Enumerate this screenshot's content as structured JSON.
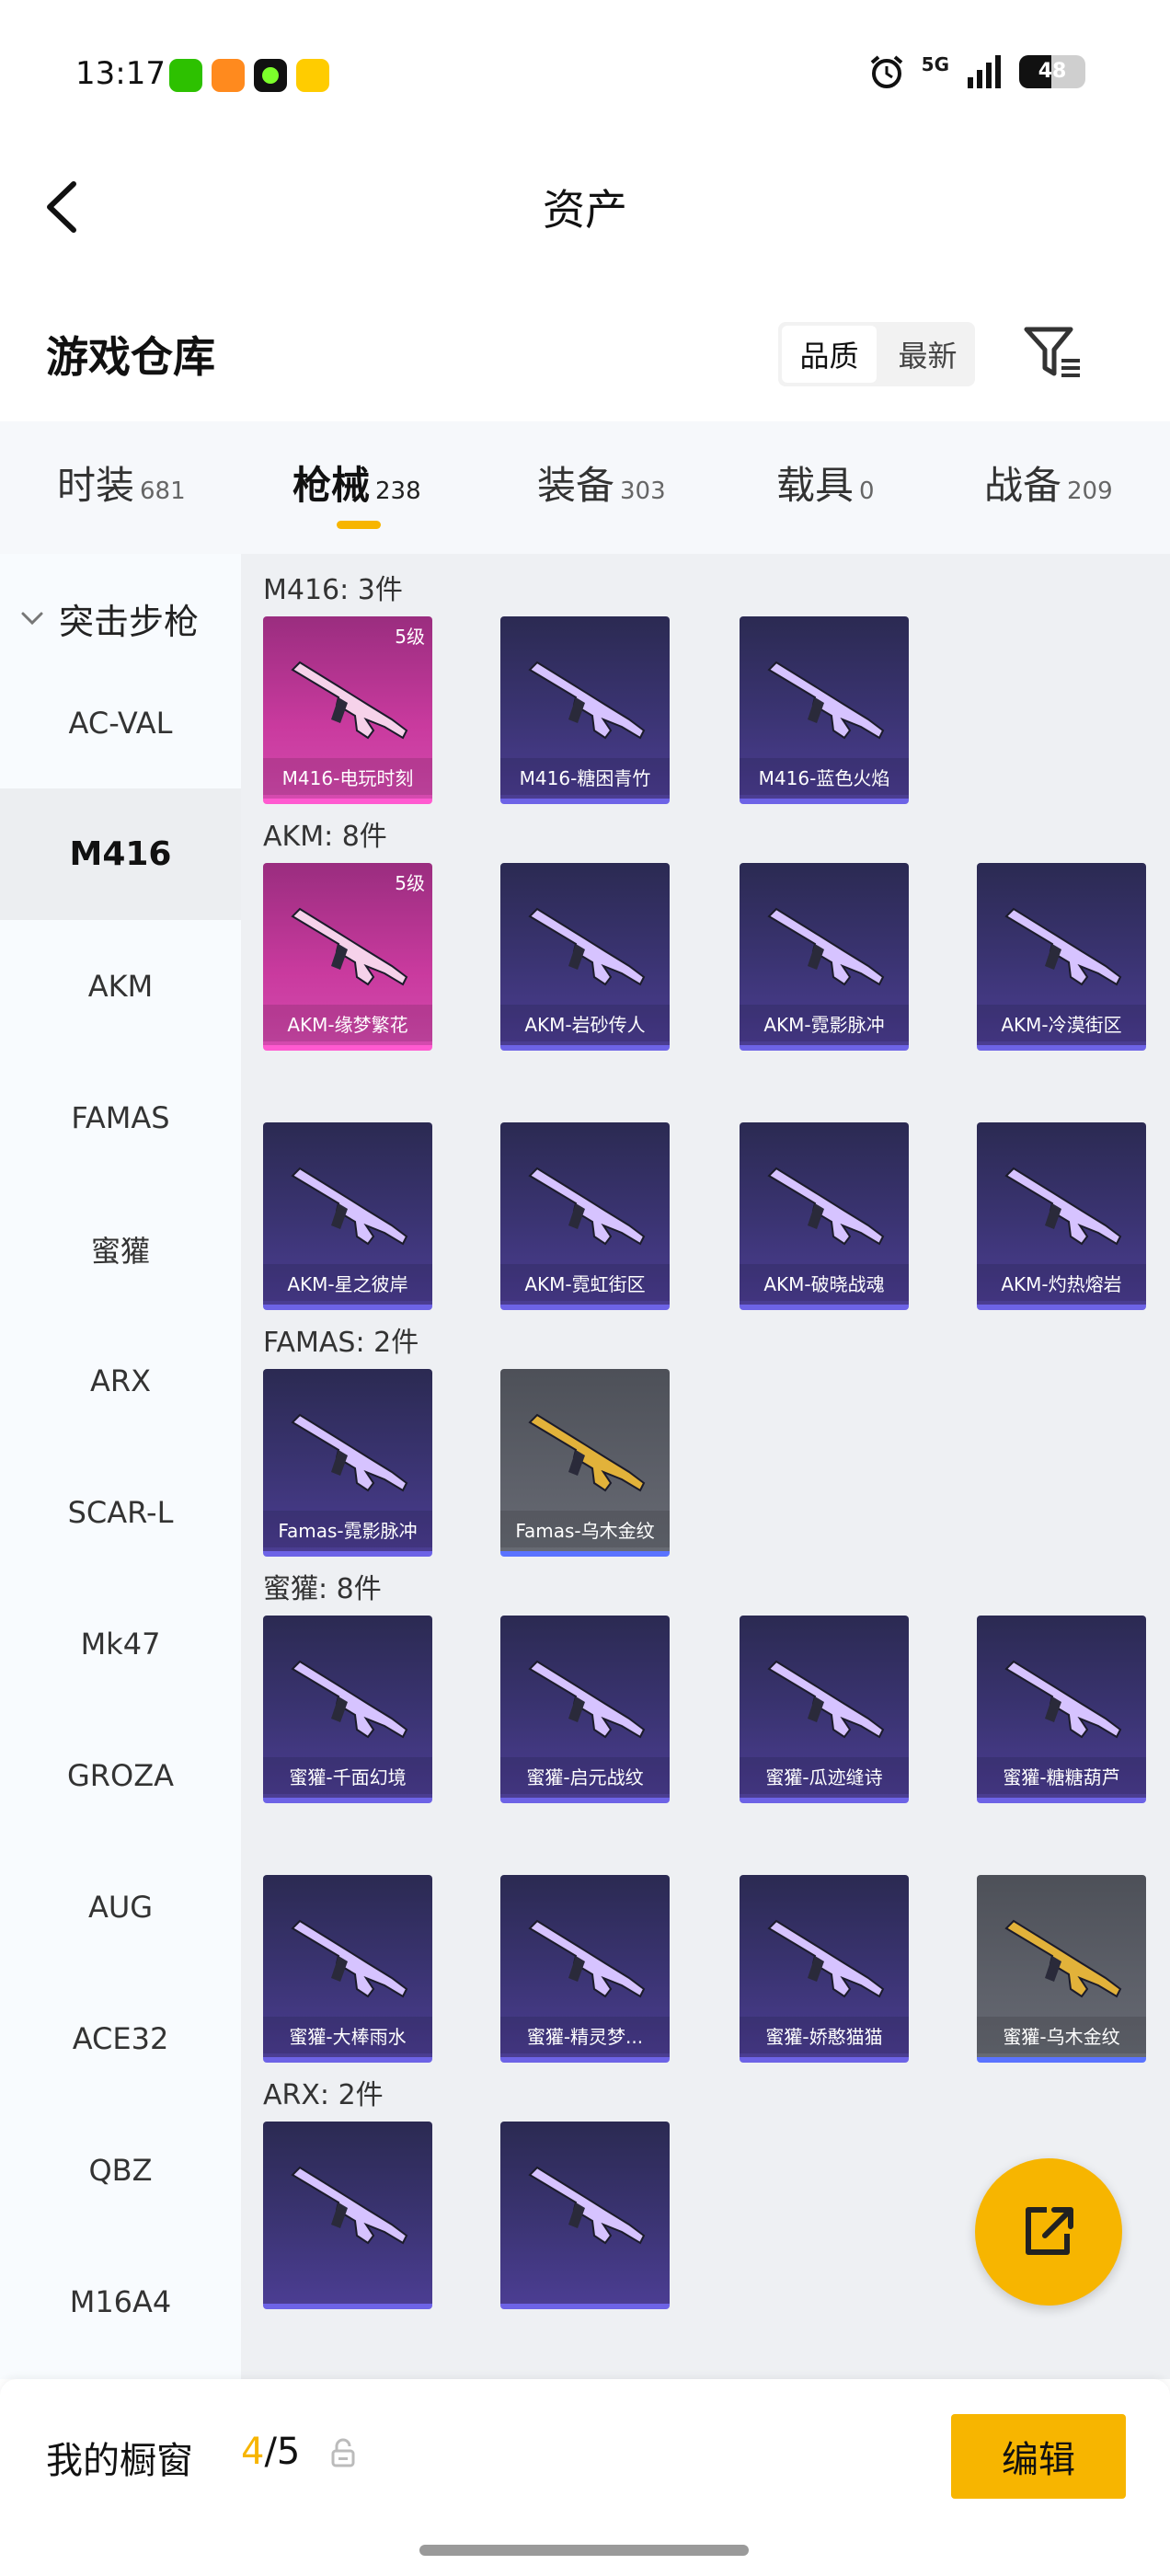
{
  "status_bar": {
    "time": "13:17",
    "network": "5G",
    "battery": "48",
    "battery_level": 0.48,
    "app_icons": [
      {
        "name": "wechat-icon",
        "color": "#2dc100"
      },
      {
        "name": "orange-app-icon",
        "color": "#ff8a1e"
      },
      {
        "name": "green-dot-app-icon",
        "color": "#111111"
      },
      {
        "name": "yellow-app-icon",
        "color": "#ffcc00"
      }
    ]
  },
  "header": {
    "title": "资产"
  },
  "warehouse": {
    "title": "游戏仓库",
    "sort_options": [
      "品质",
      "最新"
    ],
    "active_sort": 0
  },
  "tabs": [
    {
      "label": "时装",
      "count": "681"
    },
    {
      "label": "枪械",
      "count": "238",
      "active": true
    },
    {
      "label": "装备",
      "count": "303"
    },
    {
      "label": "载具",
      "count": "0"
    },
    {
      "label": "战备",
      "count": "209"
    }
  ],
  "sidebar": {
    "category": "突击步枪",
    "items": [
      "AC-VAL",
      "M416",
      "AKM",
      "FAMAS",
      "蜜獾",
      "ARX",
      "SCAR-L",
      "Mk47",
      "GROZA",
      "AUG",
      "ACE32",
      "QBZ",
      "M16A4"
    ],
    "selected": 1
  },
  "groups": [
    {
      "title": "M416: 3件",
      "items": [
        {
          "label": "M416-电玩时刻",
          "level": "5级",
          "style": "pink"
        },
        {
          "label": "M416-糖困青竹",
          "style": "purple"
        },
        {
          "label": "M416-蓝色火焰",
          "style": "purple"
        }
      ]
    },
    {
      "title": "AKM: 8件",
      "items": [
        {
          "label": "AKM-缘梦繁花",
          "level": "5级",
          "style": "pink"
        },
        {
          "label": "AKM-岩砂传人",
          "style": "purple"
        },
        {
          "label": "AKM-霓影脉冲",
          "style": "purple"
        },
        {
          "label": "AKM-冷漠街区",
          "style": "purple"
        },
        {
          "label": "AKM-星之彼岸",
          "style": "purple"
        },
        {
          "label": "AKM-霓虹街区",
          "style": "purple"
        },
        {
          "label": "AKM-破晓战魂",
          "style": "purple"
        },
        {
          "label": "AKM-灼热熔岩",
          "style": "purple"
        }
      ]
    },
    {
      "title": "FAMAS: 2件",
      "items": [
        {
          "label": "Famas-霓影脉冲",
          "style": "purple"
        },
        {
          "label": "Famas-乌木金纹",
          "style": "gray"
        }
      ]
    },
    {
      "title": "蜜獾: 8件",
      "items": [
        {
          "label": "蜜獾-千面幻境",
          "style": "purple"
        },
        {
          "label": "蜜獾-启元战纹",
          "style": "purple"
        },
        {
          "label": "蜜獾-瓜迹缝诗",
          "style": "purple"
        },
        {
          "label": "蜜獾-糖糖葫芦",
          "style": "purple"
        },
        {
          "label": "蜜獾-大棒雨水",
          "style": "purple"
        },
        {
          "label": "蜜獾-精灵梦...",
          "style": "purple"
        },
        {
          "label": "蜜獾-娇憨猫猫",
          "style": "purple"
        },
        {
          "label": "蜜獾-乌木金纹",
          "style": "gray"
        }
      ]
    },
    {
      "title": "ARX: 2件",
      "items": [
        {
          "label": "",
          "style": "purple"
        },
        {
          "label": "",
          "style": "purple"
        }
      ]
    }
  ],
  "bottom_bar": {
    "showcase_label": "我的橱窗",
    "showcase_current": "4",
    "showcase_total": "/5",
    "edit_label": "编辑"
  },
  "colors": {
    "accent": "#f7b500",
    "card_purple": "#3b3473",
    "card_pink": "#c93a9e",
    "card_gray": "#5d6069"
  }
}
